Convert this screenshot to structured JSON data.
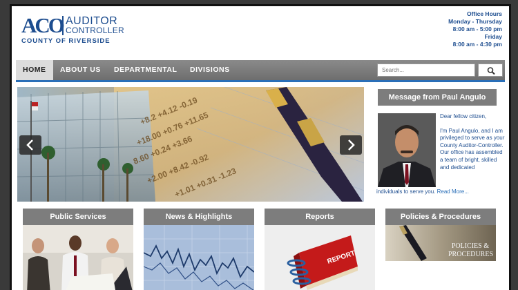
{
  "header": {
    "logo": {
      "mark": "ACO",
      "line1": "AUDITOR",
      "line2": "CONTROLLER",
      "line3": "COUNTY OF RIVERSIDE"
    },
    "hours": {
      "title": "Office Hours",
      "line1": "Monday - Thursday",
      "line2": "8:00 am - 5:00 pm",
      "line3": "Friday",
      "line4": "8:00 am - 4:30 pm"
    }
  },
  "nav": {
    "items": [
      {
        "label": "HOME",
        "active": true
      },
      {
        "label": "ABOUT US"
      },
      {
        "label": "DEPARTMENTAL"
      },
      {
        "label": "DIVISIONS"
      }
    ],
    "search_placeholder": "Search..."
  },
  "slider": {
    "prev_icon": "chevron-left-icon",
    "next_icon": "chevron-right-icon"
  },
  "message": {
    "title": "Message from Paul Angulo",
    "greeting": "Dear fellow citizen,",
    "body": "I'm Paul Angulo, and I am privileged to serve as your County Auditor-Controller. Our office has assembled a team of bright, skilled and dedicated",
    "tail": "individuals to serve you.",
    "read_more": "Read More..."
  },
  "cards": [
    {
      "title": "Public Services"
    },
    {
      "title": "News & Highlights"
    },
    {
      "title": "Reports",
      "badge": "REPORT"
    },
    {
      "title": "Policies & Procedures",
      "overlay_line1": "POLICIES &",
      "overlay_line2": "PROCEDURES"
    }
  ],
  "colors": {
    "brand_blue": "#1d4d8f",
    "nav_gray": "#7d7d7d",
    "accent_blue": "#2a6fb8"
  }
}
